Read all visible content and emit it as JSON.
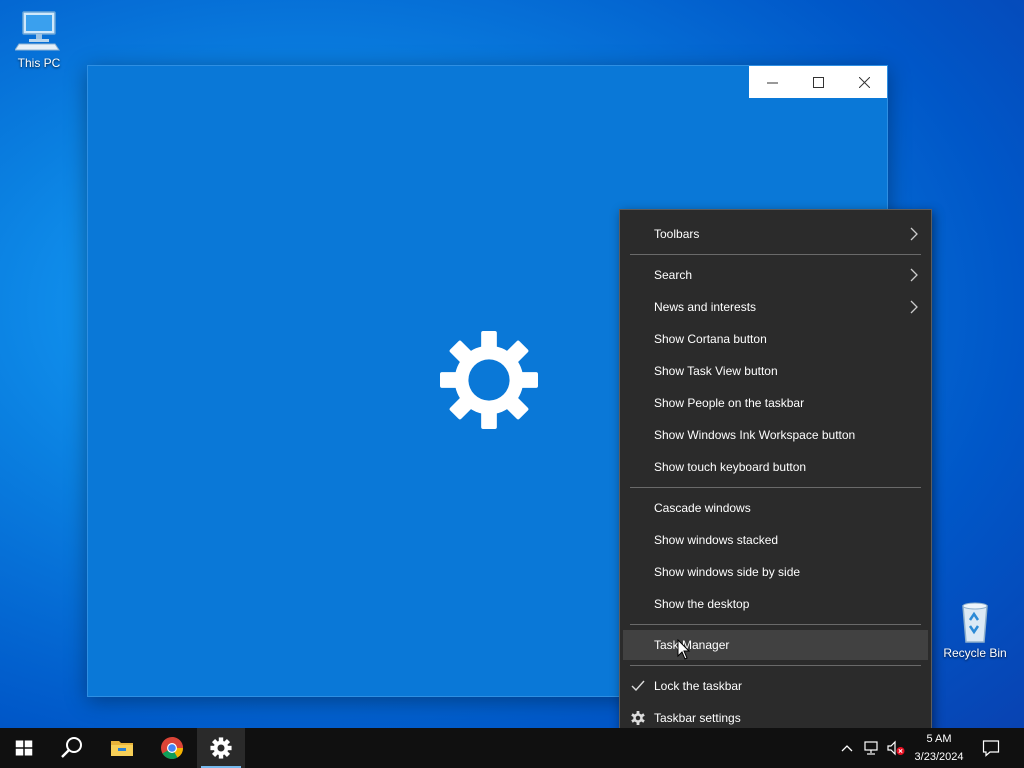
{
  "desktop": {
    "icons": [
      {
        "label": "This PC"
      },
      {
        "label": "Recycle Bin"
      }
    ]
  },
  "window": {
    "caption": {
      "minimize": "minimize-icon",
      "maximize": "maximize-icon",
      "close": "close-icon"
    },
    "splash_icon": "gear-icon",
    "background_color": "#0a78d7"
  },
  "context_menu": {
    "items": [
      {
        "label": "Toolbars",
        "submenu": true
      },
      {
        "label": "Search",
        "submenu": true
      },
      {
        "label": "News and interests",
        "submenu": true
      },
      {
        "label": "Show Cortana button"
      },
      {
        "label": "Show Task View button"
      },
      {
        "label": "Show People on the taskbar"
      },
      {
        "label": "Show Windows Ink Workspace button"
      },
      {
        "label": "Show touch keyboard button"
      },
      {
        "label": "Cascade windows"
      },
      {
        "label": "Show windows stacked"
      },
      {
        "label": "Show windows side by side"
      },
      {
        "label": "Show the desktop"
      },
      {
        "label": "Task Manager",
        "hovered": true
      },
      {
        "label": "Lock the taskbar",
        "checked": true
      },
      {
        "label": "Taskbar settings",
        "icon": "gear-icon"
      }
    ]
  },
  "taskbar": {
    "pinned": [
      "windows-start-icon",
      "search-icon",
      "file-explorer-icon",
      "chrome-icon",
      "settings-gear-icon"
    ],
    "active": "settings-gear-icon",
    "clock": {
      "time": "5 AM",
      "date": "3/23/2024"
    },
    "tray": [
      "chevron-up-icon",
      "network-icon",
      "volume-muted-icon",
      "notification-icon"
    ]
  },
  "colors": {
    "menu_bg": "#2b2b2b",
    "menu_hover": "#414141",
    "taskbar_bg": "#101010",
    "accent": "#76b9ed"
  }
}
